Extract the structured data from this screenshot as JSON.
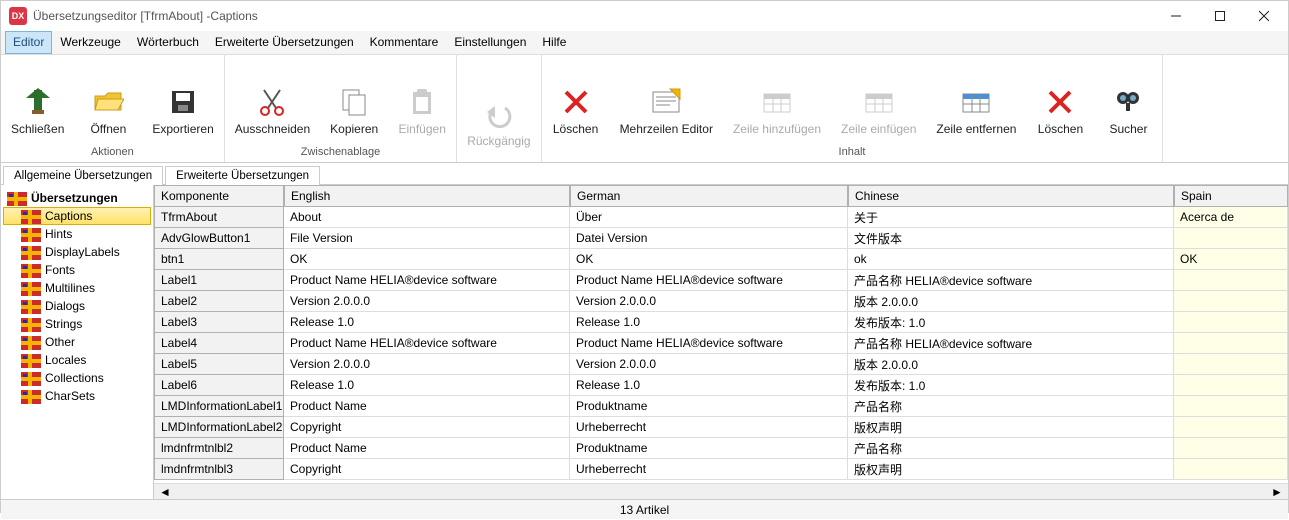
{
  "window": {
    "title": "Übersetzungseditor [TfrmAbout] -Captions",
    "icon_text": "DX"
  },
  "menu": [
    "Editor",
    "Werkzeuge",
    "Wörterbuch",
    "Erweiterte Übersetzungen",
    "Kommentare",
    "Einstellungen",
    "Hilfe"
  ],
  "menu_active_index": 0,
  "toolbar_groups": [
    {
      "label": "Aktionen",
      "buttons": [
        {
          "id": "close-btn",
          "label": "Schließen",
          "enabled": true
        },
        {
          "id": "open-btn",
          "label": "Öffnen",
          "enabled": true
        },
        {
          "id": "export-btn",
          "label": "Exportieren",
          "enabled": true
        }
      ]
    },
    {
      "label": "Zwischenablage",
      "buttons": [
        {
          "id": "cut-btn",
          "label": "Ausschneiden",
          "enabled": true
        },
        {
          "id": "copy-btn",
          "label": "Kopieren",
          "enabled": true
        },
        {
          "id": "paste-btn",
          "label": "Einfügen",
          "enabled": false
        }
      ]
    },
    {
      "label": "",
      "buttons": [
        {
          "id": "undo-btn",
          "label": "Rückgängig",
          "enabled": false
        }
      ]
    },
    {
      "label": "Inhalt",
      "buttons": [
        {
          "id": "delete-btn",
          "label": "Löschen",
          "enabled": true
        },
        {
          "id": "multiline-btn",
          "label": "Mehrzeilen Editor",
          "enabled": true
        },
        {
          "id": "addrow-btn",
          "label": "Zeile hinzufügen",
          "enabled": false
        },
        {
          "id": "insrow-btn",
          "label": "Zeile einfügen",
          "enabled": false
        },
        {
          "id": "delrow-btn",
          "label": "Zeile entfernen",
          "enabled": true
        },
        {
          "id": "delete2-btn",
          "label": "Löschen",
          "enabled": true
        },
        {
          "id": "search-btn",
          "label": "Sucher",
          "enabled": true
        }
      ]
    }
  ],
  "tabs": [
    "Allgemeine Übersetzungen",
    "Erweiterte Übersetzungen"
  ],
  "tabs_active_index": 0,
  "sidebar": {
    "header": "Übersetzungen",
    "items": [
      "Captions",
      "Hints",
      "DisplayLabels",
      "Fonts",
      "Multilines",
      "Dialogs",
      "Strings",
      "Other",
      "Locales",
      "Collections",
      "CharSets"
    ],
    "active_index": 0
  },
  "grid": {
    "columns": [
      "Komponente",
      "English",
      "German",
      "Chinese",
      "Spain"
    ],
    "rows": [
      {
        "comp": "TfrmAbout",
        "en": "About",
        "de": "Über",
        "cn": "关于",
        "es": "Acerca de"
      },
      {
        "comp": "AdvGlowButton1",
        "en": "File Version",
        "de": "Datei Version",
        "cn": "文件版本",
        "es": ""
      },
      {
        "comp": "btn1",
        "en": "OK",
        "de": "OK",
        "cn": "ok",
        "es": "OK"
      },
      {
        "comp": "Label1",
        "en": "Product Name HELIA®device software",
        "de": "Product Name HELIA®device software",
        "cn": "产品名称 HELIA®device software",
        "es": ""
      },
      {
        "comp": "Label2",
        "en": "Version 2.0.0.0",
        "de": "Version 2.0.0.0",
        "cn": "版本 2.0.0.0",
        "es": ""
      },
      {
        "comp": "Label3",
        "en": "Release 1.0",
        "de": "Release 1.0",
        "cn": "发布版本: 1.0",
        "es": ""
      },
      {
        "comp": "Label4",
        "en": "Product Name HELIA®device software",
        "de": "Product Name HELIA®device software",
        "cn": "产品名称 HELIA®device software",
        "es": ""
      },
      {
        "comp": "Label5",
        "en": "Version 2.0.0.0",
        "de": "Version 2.0.0.0",
        "cn": "版本 2.0.0.0",
        "es": ""
      },
      {
        "comp": "Label6",
        "en": "Release 1.0",
        "de": "Release 1.0",
        "cn": "发布版本: 1.0",
        "es": ""
      },
      {
        "comp": "LMDInformationLabel1",
        "en": "Product Name",
        "de": "Produktname",
        "cn": "产品名称",
        "es": ""
      },
      {
        "comp": "LMDInformationLabel2",
        "en": "Copyright",
        "de": "Urheberrecht",
        "cn": "版权声明",
        "es": ""
      },
      {
        "comp": "lmdnfrmtnlbl2",
        "en": "Product Name",
        "de": "Produktname",
        "cn": "产品名称",
        "es": ""
      },
      {
        "comp": "lmdnfrmtnlbl3",
        "en": "Copyright",
        "de": "Urheberrecht",
        "cn": "版权声明",
        "es": ""
      }
    ]
  },
  "status": "13 Artikel"
}
